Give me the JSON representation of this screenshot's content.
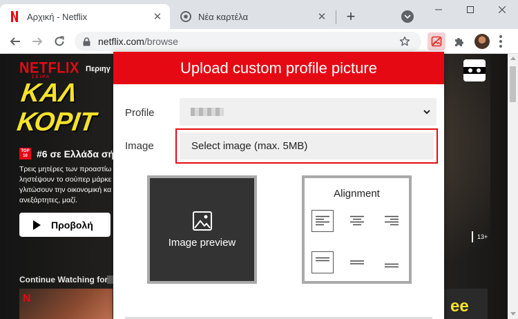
{
  "browser": {
    "tabs": [
      {
        "title": "Αρχική - Netflix",
        "active": true
      },
      {
        "title": "Νέα καρτέλα",
        "active": false
      }
    ],
    "url_host": "netflix.com",
    "url_path": "/browse"
  },
  "netflix": {
    "logo": "NETFLIX",
    "logo_sub": "ΣΕΙΡΑ",
    "nav_item": "Περιηγ",
    "show_title_line1": "ΚΑΛ",
    "show_title_line2": "ΚΟΡΙΤ",
    "top10_badge_line1": "TOP",
    "top10_badge_line2": "10",
    "top10_text": "#6 σε Ελλάδα σήμερ",
    "description": "Τρεις μητέρες των προαστίω ληστέψουν το σούπερ μάρκε γλιτώσουν την οικονομική κα ανεξάρτητες, μαζί.",
    "play_label": "Προβολή",
    "row_title": "Continue Watching for",
    "rating": "13+",
    "thumb_text": "ee"
  },
  "popup": {
    "title": "Upload custom profile picture",
    "profile_label": "Profile",
    "image_label": "Image",
    "select_image_label": "Select image (max. 5MB)",
    "preview_label": "Image preview",
    "alignment_label": "Alignment",
    "alignment_selected": [
      "top-left",
      "bottom-left"
    ]
  },
  "colors": {
    "brand_red": "#e50914",
    "accent_yellow": "#f5e22a"
  }
}
